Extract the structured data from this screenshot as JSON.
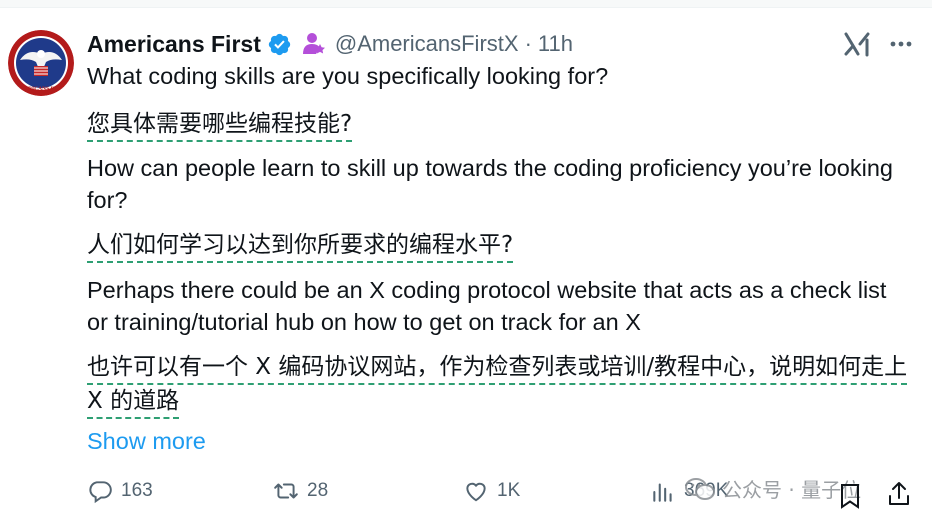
{
  "author": {
    "display_name": "Americans First",
    "handle": "@AmericansFirstX",
    "separator": "·",
    "time": "11h",
    "avatar_text": "AMERICANS FIRST"
  },
  "icons": {
    "verified": "verified-badge-icon",
    "affiliate": "affiliate-badge-icon",
    "grok": "grok-icon",
    "more": "more-options-icon",
    "reply": "reply-icon",
    "retweet": "retweet-icon",
    "like": "like-icon",
    "views": "views-icon",
    "bookmark": "bookmark-icon",
    "share": "share-icon"
  },
  "colors": {
    "link": "#1d9bf0",
    "verified": "#1d9bf0",
    "affiliate": "#b44fd9",
    "translation_underline": "#2e9f73",
    "muted": "#536471"
  },
  "content": {
    "p1_en": "What coding skills are you specifically looking for?",
    "p1_zh": "您具体需要哪些编程技能?",
    "p2_en": "How can people learn to skill up towards the coding proficiency you’re looking for?",
    "p2_zh": "人们如何学习以达到你所要求的编程水平?",
    "p3_en": "Perhaps there could be an X coding protocol website that acts as a check list or training/tutorial hub on how to get on track for an X",
    "p3_zh": "也许可以有一个 X 编码协议网站，作为检查列表或培训/教程中心，说明如何走上 X 的道路",
    "show_more": "Show more"
  },
  "stats": {
    "replies": "163",
    "retweets": "28",
    "likes": "1K",
    "views": "369K"
  },
  "watermark": {
    "text": "公众号 · 量子位"
  }
}
